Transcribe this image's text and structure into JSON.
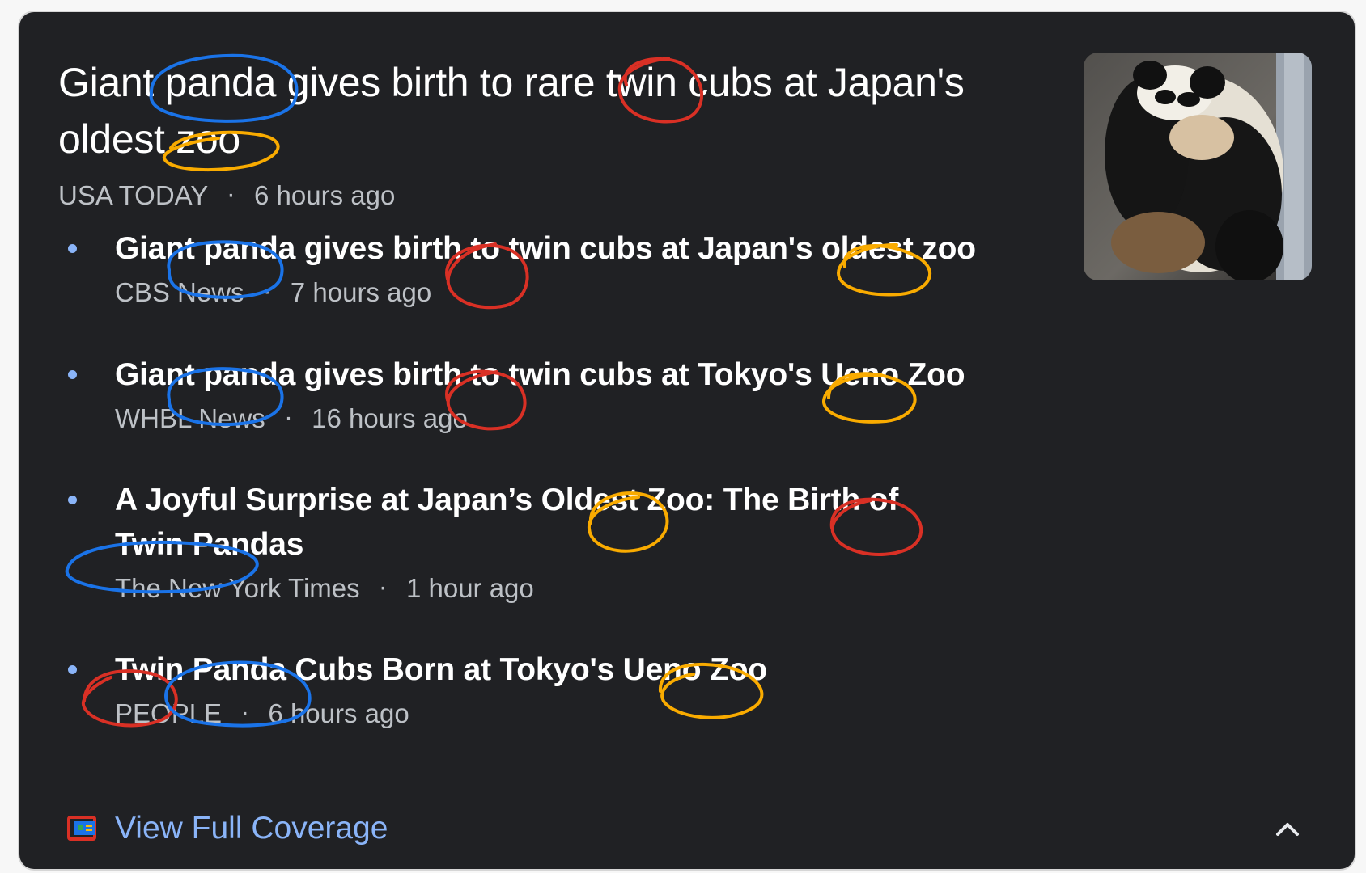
{
  "top_story": {
    "headline": "Giant panda gives birth to rare twin cubs at Japan's oldest zoo",
    "source": "USA TODAY",
    "separator": "·",
    "time": "6 hours ago"
  },
  "stories": [
    {
      "title": "Giant panda gives birth to twin cubs at Japan's oldest zoo",
      "source": "CBS News",
      "time": "7 hours ago"
    },
    {
      "title": "Giant panda gives birth to twin cubs at Tokyo's Ueno Zoo",
      "source": "WHBL News",
      "time": "16 hours ago"
    },
    {
      "title": "A Joyful Surprise at Japan’s Oldest Zoo: The Birth of Twin Pandas",
      "source": "The New York Times",
      "time": "1 hour ago"
    },
    {
      "title": "Twin Panda Cubs Born at Tokyo's Ueno Zoo",
      "source": "PEOPLE",
      "time": "6 hours ago"
    }
  ],
  "footer": {
    "coverage_label": "View Full Coverage",
    "coverage_icon": "full-coverage-icon",
    "collapse_icon": "chevron-up-icon"
  },
  "colors": {
    "card_background": "#202124",
    "link_blue": "#8ab4f8",
    "annotation_blue": "#1a73e8",
    "annotation_red": "#d93025",
    "annotation_orange": "#f9ab00"
  }
}
